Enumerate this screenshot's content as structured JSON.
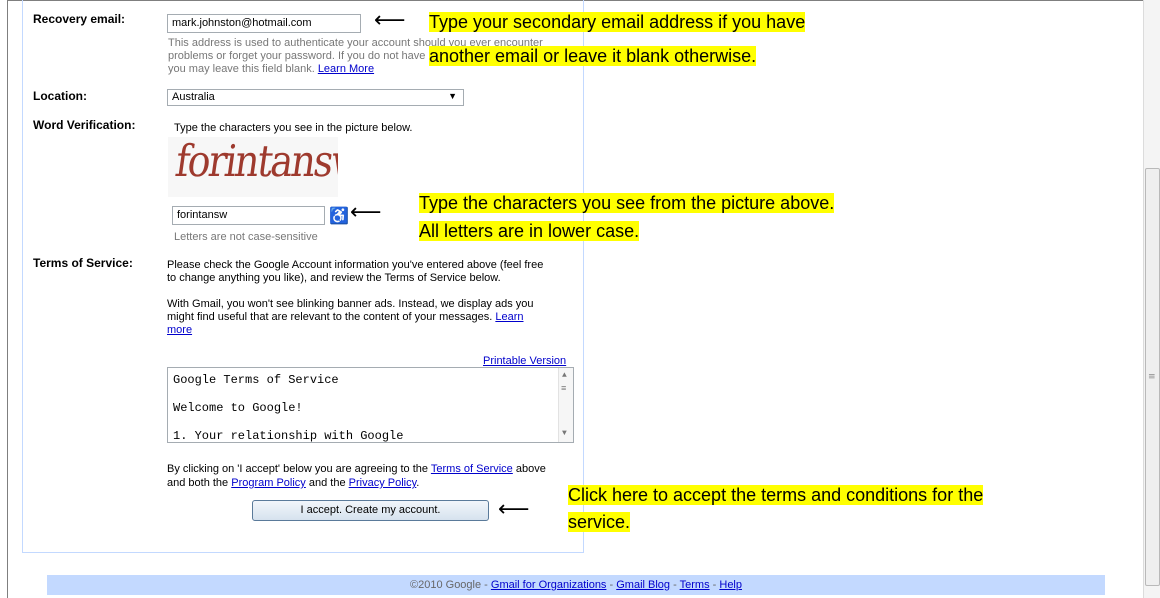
{
  "recovery": {
    "label": "Recovery email:",
    "value": "mark.johnston@hotmail.com",
    "help_line1": "This address is used to authenticate your account should you ever encounter",
    "help_line2": "problems or forget your password. If you do not have",
    "help_line3": "you may leave this field blank.",
    "learn_more": "Learn More"
  },
  "location": {
    "label": "Location:",
    "value": "Australia"
  },
  "verification": {
    "label": "Word Verification:",
    "instruction": "Type the characters you see in the picture below.",
    "captcha_text": "forintansw",
    "input_value": "forintansw",
    "hint": "Letters are not case-sensitive",
    "accessibility_icon": "wheelchair-icon"
  },
  "terms": {
    "label": "Terms of Service:",
    "para1_line1": "Please check the Google Account information you've entered above (feel free",
    "para1_line2": "to change anything you like), and review the Terms of Service below.",
    "para2_line1": "With Gmail, you won't see blinking banner ads. Instead, we display ads you",
    "para2_line2": "might find useful that are relevant to the content of your messages.",
    "para2_learn": "Learn",
    "para2_more": "more",
    "printable": "Printable Version",
    "box_lines": [
      "Google Terms of Service",
      "Welcome to Google!",
      "1. Your relationship with Google"
    ],
    "agree_prefix": "By clicking on 'I accept' below you are agreeing to the",
    "agree_tos_link": "Terms of Service",
    "agree_above": "above",
    "agree_line2_prefix": "and both the",
    "program_policy": "Program Policy",
    "and_the": "and the",
    "privacy_policy": "Privacy Policy",
    "period": ".",
    "accept_button": "I accept. Create my account."
  },
  "annotations": {
    "note1_line1": "Type your secondary email address if you have",
    "note1_line2": "another email or leave it blank otherwise.",
    "note2_line1": "Type the characters you see from the picture above.",
    "note2_line2": "All letters are in lower case.",
    "note3_line1": "Click here to accept the terms and conditions for the",
    "note3_line2": "service.",
    "arrow": "⟵",
    "highlight_color": "#ffff00"
  },
  "footer": {
    "copyright": "©2010 Google -",
    "links": [
      "Gmail for Organizations",
      "Gmail Blog",
      "Terms",
      "Help"
    ],
    "separator": "-"
  }
}
